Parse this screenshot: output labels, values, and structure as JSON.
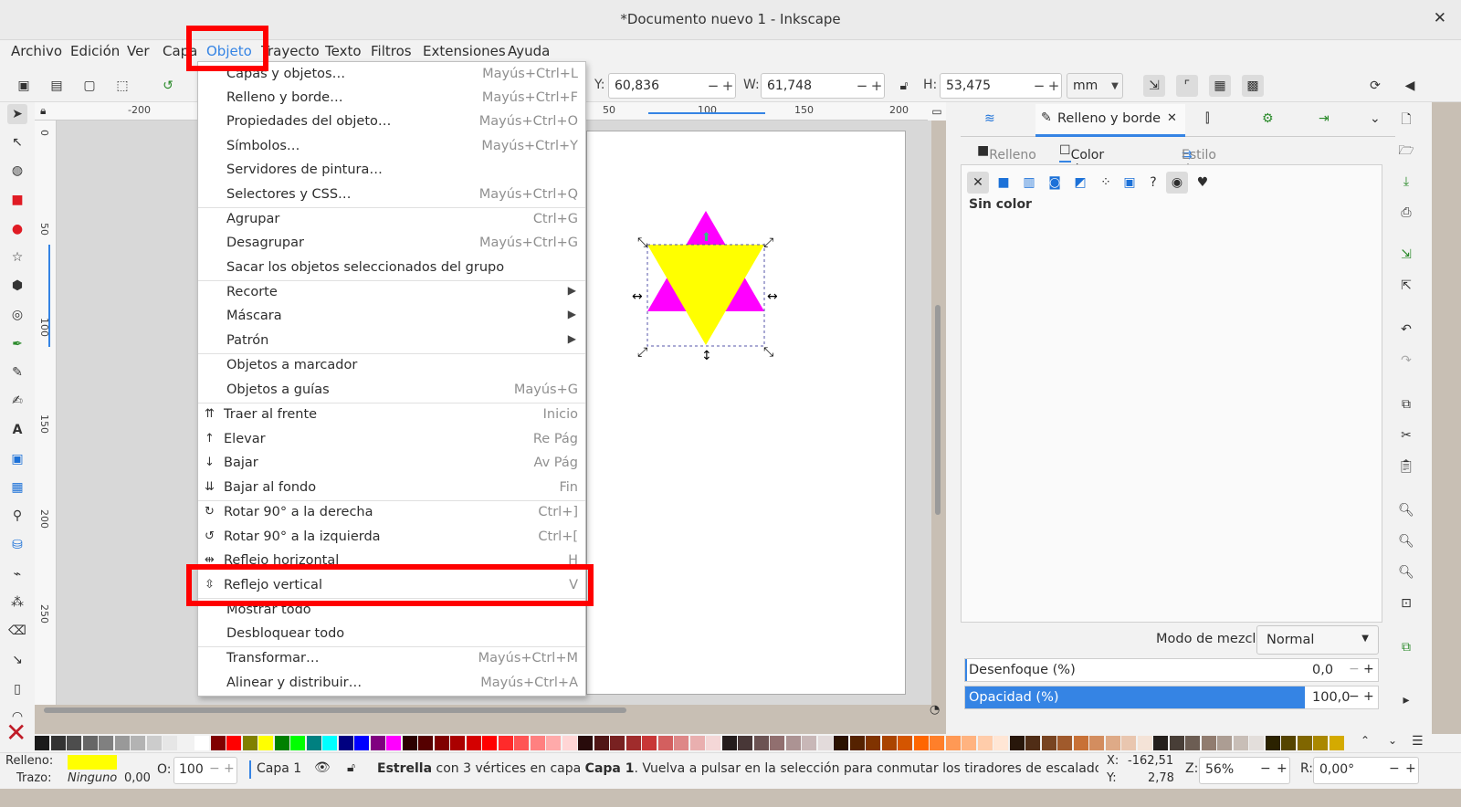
{
  "window": {
    "title": "*Documento nuevo 1 - Inkscape",
    "close": "✕"
  },
  "menubar": {
    "items": [
      "Archivo",
      "Edición",
      "Ver",
      "Capa",
      "Objeto",
      "Trayecto",
      "Texto",
      "Filtros",
      "Extensiones",
      "Ayuda"
    ],
    "active": "Objeto"
  },
  "toolbar": {
    "y_label": "Y:",
    "y_value": "60,836",
    "w_label": "W:",
    "w_value": "61,748",
    "h_label": "H:",
    "h_value": "53,475",
    "unit": "mm"
  },
  "ruler": {
    "h_ticks": [
      "-200",
      "50",
      "100",
      "150",
      "200"
    ],
    "v_ticks": [
      "0",
      "50",
      "100",
      "150",
      "200",
      "250"
    ]
  },
  "object_menu": {
    "items": [
      {
        "label": "Capas y objetos…",
        "shortcut": "Mayús+Ctrl+L"
      },
      {
        "label": "Relleno y borde…",
        "shortcut": "Mayús+Ctrl+F"
      },
      {
        "label": "Propiedades del objeto…",
        "shortcut": "Mayús+Ctrl+O"
      },
      {
        "label": "Símbolos…",
        "shortcut": "Mayús+Ctrl+Y"
      },
      {
        "label": "Servidores de pintura…",
        "shortcut": ""
      },
      {
        "label": "Selectores y CSS…",
        "shortcut": "Mayús+Ctrl+Q"
      },
      {
        "label": "Agrupar",
        "shortcut": "Ctrl+G"
      },
      {
        "label": "Desagrupar",
        "shortcut": "Mayús+Ctrl+G"
      },
      {
        "label": "Sacar los objetos seleccionados del grupo",
        "shortcut": ""
      },
      {
        "label": "Recorte",
        "shortcut": ""
      },
      {
        "label": "Máscara",
        "shortcut": ""
      },
      {
        "label": "Patrón",
        "shortcut": ""
      },
      {
        "label": "Objetos a marcador",
        "shortcut": ""
      },
      {
        "label": "Objetos a guías",
        "shortcut": "Mayús+G"
      },
      {
        "label": "Traer al frente",
        "shortcut": "Inicio"
      },
      {
        "label": "Elevar",
        "shortcut": "Re Pág"
      },
      {
        "label": "Bajar",
        "shortcut": "Av Pág"
      },
      {
        "label": "Bajar al fondo",
        "shortcut": "Fin"
      },
      {
        "label": "Rotar 90° a la derecha",
        "shortcut": "Ctrl+]"
      },
      {
        "label": "Rotar 90° a la izquierda",
        "shortcut": "Ctrl+["
      },
      {
        "label": "Reflejo horizontal",
        "shortcut": "H"
      },
      {
        "label": "Reflejo vertical",
        "shortcut": "V"
      },
      {
        "label": "Mostrar todo",
        "shortcut": ""
      },
      {
        "label": "Desbloquear todo",
        "shortcut": ""
      },
      {
        "label": "Transformar…",
        "shortcut": "Mayús+Ctrl+M"
      },
      {
        "label": "Alinear y distribuir…",
        "shortcut": "Mayús+Ctrl+A"
      }
    ]
  },
  "dock": {
    "tab_title": "Relleno y borde",
    "subtabs": [
      "Relleno",
      "Color de trazo",
      "Estilo de trazo"
    ],
    "active_subtab": "Color de trazo",
    "paint_status": "Sin color",
    "blend_label": "Modo de mezcla:",
    "blend_value": "Normal",
    "blur_label": "Desenfoque (%)",
    "blur_value": "0,0",
    "opacity_label": "Opacidad (%)",
    "opacity_value": "100,0"
  },
  "status": {
    "fill_label": "Relleno:",
    "fill_color": "#ffff00",
    "stroke_label": "Trazo:",
    "stroke_value": "Ninguno",
    "stroke_width": "0,00",
    "opacity_label": "O:",
    "opacity_value": "100",
    "layer": "Capa 1",
    "msg_strong": "Estrella",
    "msg_mid": " con 3 vértices en capa ",
    "msg_layer": "Capa 1",
    "msg_tail": ". Vuelva a pulsar en la selección para conmutar los tiradores de escalado/rotación.",
    "x_label": "X:",
    "x_value": "-162,51",
    "y_label": "Y:",
    "y_value": "2,78",
    "zoom_label": "Z:",
    "zoom_value": "56%",
    "rot_label": "R:",
    "rot_value": "0,00°"
  },
  "colors": {
    "highlight": "#ff0000",
    "accent": "#3584e4",
    "magenta": "#ff00ff",
    "yellow": "#ffff00"
  }
}
